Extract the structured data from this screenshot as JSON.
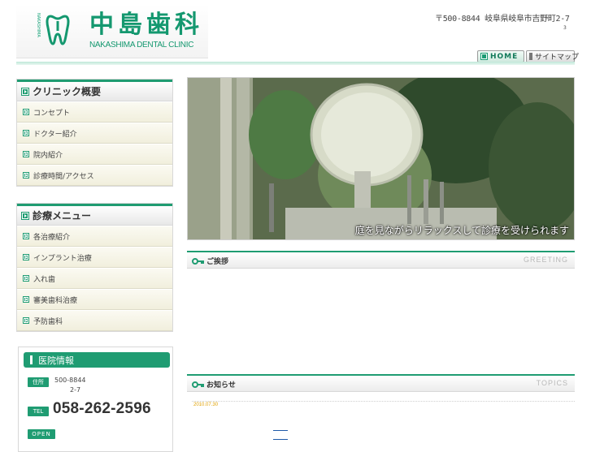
{
  "header": {
    "clinic_name_ja": "中島歯科",
    "clinic_name_en": "NAKASHIMA DENTAL CLINIC",
    "logo_vertical_text": "NAKASHIMA DENTAL CLINIC",
    "address": "〒500-8844 岐阜県岐阜市吉野町2-7",
    "address_sub": "3"
  },
  "top_nav": [
    {
      "label": "HOME"
    },
    {
      "label": "サイトマップ"
    }
  ],
  "sidebar": {
    "clinic": {
      "title": "クリニック概要",
      "items": [
        {
          "label": "コンセプト"
        },
        {
          "label": "ドクター紹介"
        },
        {
          "label": "院内紹介"
        },
        {
          "label": "診療時間/アクセス"
        }
      ]
    },
    "menu": {
      "title": "診療メニュー",
      "items": [
        {
          "label": "各治療紹介"
        },
        {
          "label": "インプラント治療"
        },
        {
          "label": "入れ歯"
        },
        {
          "label": "審美歯科治療"
        },
        {
          "label": "予防歯科"
        }
      ]
    },
    "info": {
      "title": "医院情報",
      "address_tag": "住所",
      "zip": "500-8844",
      "address_num": "2-7",
      "tel_tag": "TEL",
      "tel": "058-262-2596",
      "open_tag": "OPEN"
    }
  },
  "hero": {
    "caption": "庭を見ながらリラックスして診療を受けられます"
  },
  "greeting": {
    "title": "ご挨拶",
    "title_en": "GREETING"
  },
  "news": {
    "title": "お知らせ",
    "title_en": "TOPICS",
    "date": "2010.07.30"
  },
  "colors": {
    "brand_green": "#1f9c72",
    "date_orange": "#e0a000"
  }
}
